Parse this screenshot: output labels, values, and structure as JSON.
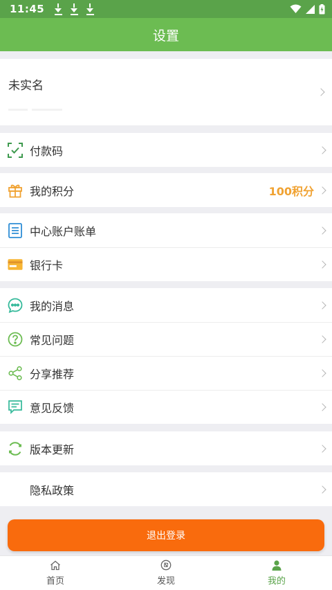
{
  "status_bar": {
    "time": "11:45"
  },
  "nav": {
    "title": "设置"
  },
  "profile": {
    "name": "未实名"
  },
  "menu": {
    "pay_code": "付款码",
    "points": "我的积分",
    "points_value": "100积分",
    "account_bill": "中心账户账单",
    "bank_card": "银行卡",
    "messages": "我的消息",
    "faq": "常见问题",
    "share": "分享推荐",
    "feedback": "意见反馈",
    "update": "版本更新",
    "privacy": "隐私政策"
  },
  "logout_label": "退出登录",
  "tabs": [
    {
      "label": "首页",
      "icon": "home-icon"
    },
    {
      "label": "发现",
      "icon": "compass-icon"
    },
    {
      "label": "我的",
      "icon": "user-icon",
      "active": true
    }
  ],
  "colors": {
    "status_bar": "#5aa34a",
    "nav_bar": "#6cbc52",
    "accent_orange": "#f96b0d",
    "points_orange": "#f0a232",
    "tab_active": "#5aa34a"
  }
}
